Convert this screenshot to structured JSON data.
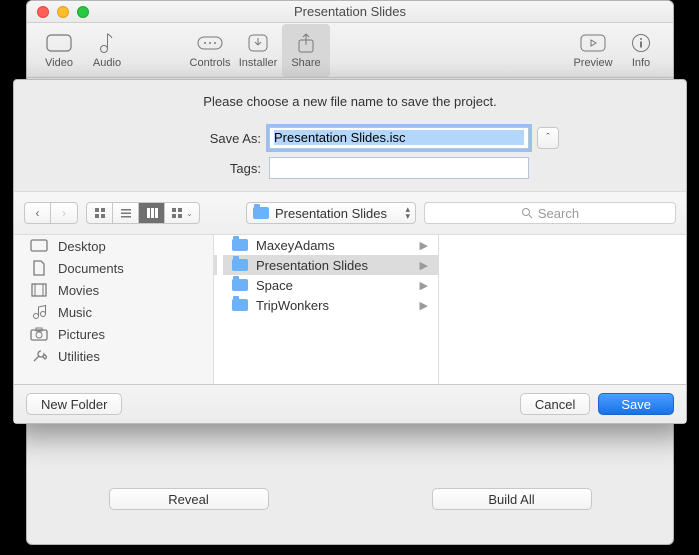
{
  "window": {
    "title": "Presentation Slides"
  },
  "toolbar": {
    "items": [
      "Video",
      "Audio",
      "Controls",
      "Installer",
      "Share",
      "Preview",
      "Info"
    ]
  },
  "sheet": {
    "prompt": "Please choose a new file name to save the project.",
    "saveas_label": "Save As:",
    "saveas_value": "Presentation Slides.isc",
    "tags_label": "Tags:",
    "tags_value": ""
  },
  "nav": {
    "location": "Presentation Slides",
    "search_placeholder": "Search"
  },
  "sidebar": {
    "items": [
      "Desktop",
      "Documents",
      "Movies",
      "Music",
      "Pictures",
      "Utilities"
    ]
  },
  "column": {
    "items": [
      {
        "name": "MaxeyAdams",
        "sel": false
      },
      {
        "name": "Presentation Slides",
        "sel": true
      },
      {
        "name": "Space",
        "sel": false
      },
      {
        "name": "TripWonkers",
        "sel": false
      }
    ]
  },
  "footer": {
    "newfolder": "New Folder",
    "cancel": "Cancel",
    "save": "Save"
  },
  "background": {
    "reveal": "Reveal",
    "buildall": "Build All"
  }
}
